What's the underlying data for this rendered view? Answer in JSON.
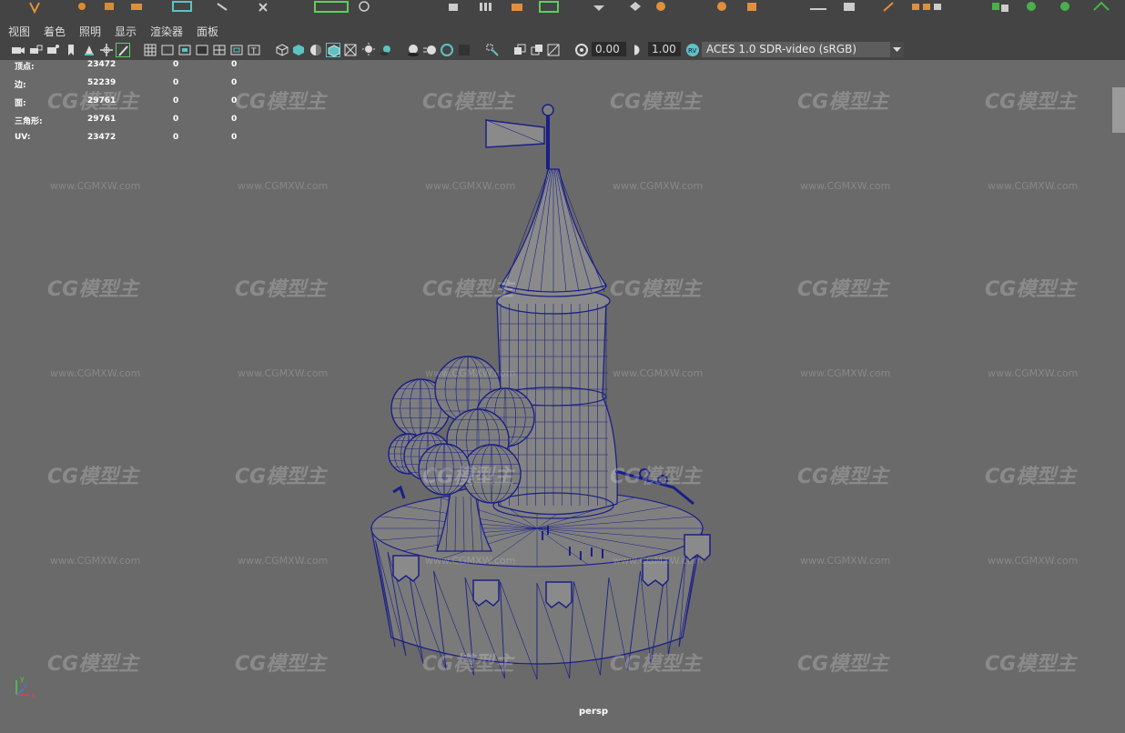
{
  "menu": [
    "视图",
    "着色",
    "照明",
    "显示",
    "渲染器",
    "面板"
  ],
  "toolbar": {
    "field_a_value": "0.00",
    "field_b_value": "1.00",
    "colorspace": "ACES 1.0 SDR-video (sRGB)",
    "icons": [
      "camera-icon",
      "camera-lock-icon",
      "camera-attr-icon",
      "bookmark-icon",
      "pin-icon",
      "pan-icon",
      "pencil-icon",
      "grid-icon",
      "film-gate-icon",
      "resolution-gate-icon",
      "gate-mask-icon",
      "field-chart-icon",
      "safe-action-icon",
      "safe-title-icon",
      "wireframe-icon",
      "smooth-shade-icon",
      "default-material-icon",
      "wireframe-on-shaded-icon",
      "xray-icon",
      "lights-icon",
      "shadows-icon",
      "ambient-occlusion-icon",
      "motion-blur-icon",
      "antialias-icon",
      "depth-of-field-icon",
      "isolate-select-icon",
      "xray-joints-icon",
      "xray-active-icon",
      "backface-icon",
      "exposure-icon",
      "gamma-icon",
      "colorspace-icon"
    ]
  },
  "hud": {
    "rows": [
      {
        "label": "顶点:",
        "v1": "23472",
        "v2": "0",
        "v3": "0"
      },
      {
        "label": "边:",
        "v1": "52239",
        "v2": "0",
        "v3": "0"
      },
      {
        "label": "面:",
        "v1": "29761",
        "v2": "0",
        "v3": "0"
      },
      {
        "label": "三角形:",
        "v1": "29761",
        "v2": "0",
        "v3": "0"
      },
      {
        "label": "UV:",
        "v1": "23472",
        "v2": "0",
        "v3": "0"
      }
    ]
  },
  "watermark": {
    "logo": "CG模型主",
    "url": "www.CGMXW.com"
  },
  "viewport": {
    "camera": "persp",
    "wire_color": "#1a1f86"
  },
  "axis": {
    "x": "x",
    "y": "y",
    "z": "z"
  }
}
